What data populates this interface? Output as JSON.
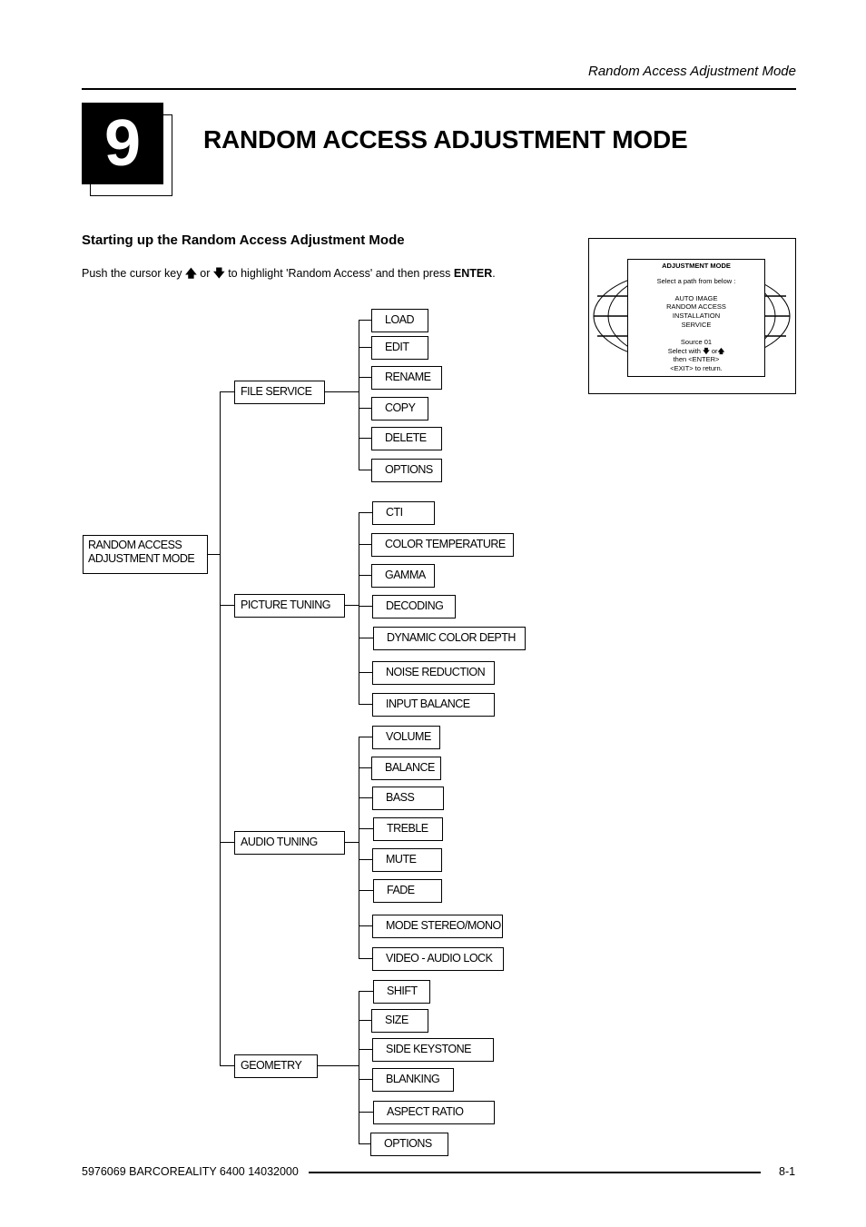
{
  "header": {
    "running_head": "Random Access Adjustment Mode"
  },
  "chapter": {
    "number": "9",
    "title": "RANDOM ACCESS ADJUSTMENT MODE"
  },
  "section": {
    "title": "Starting up the Random Access Adjustment Mode",
    "instruction": {
      "part1": "Push the cursor key ",
      "up_arrow": "🡅",
      "part2": " or ",
      "down_arrow": "🡇",
      "part3": " to highlight 'Random Access' and then press ",
      "key": "ENTER",
      "part4": "."
    }
  },
  "osd": {
    "title": "ADJUSTMENT MODE",
    "prompt": "Select  a  path  from  below  :",
    "options": [
      "AUTO  IMAGE",
      "RANDOM  ACCESS",
      "INSTALLATION",
      "SERVICE"
    ],
    "source": "Source  01",
    "select_with": "Select  with",
    "down_icon": "🡇",
    "or": "or",
    "up_icon": "🡅",
    "then": "then  <ENTER>",
    "exit": "<EXIT>  to  return."
  },
  "tree": {
    "root": {
      "line1": "RANDOM ACCESS",
      "line2": "ADJUSTMENT MODE"
    },
    "branches": [
      {
        "label": "FILE SERVICE",
        "children": [
          "LOAD",
          "EDIT",
          "RENAME",
          "COPY",
          "DELETE",
          "OPTIONS"
        ]
      },
      {
        "label": "PICTURE TUNING",
        "children": [
          "CTI",
          "COLOR TEMPERATURE",
          "GAMMA",
          "DECODING",
          "DYNAMIC COLOR DEPTH",
          "NOISE REDUCTION",
          "INPUT BALANCE"
        ]
      },
      {
        "label": "AUDIO TUNING",
        "children": [
          "VOLUME",
          "BALANCE",
          "BASS",
          "TREBLE",
          "MUTE",
          "FADE",
          "MODE STEREO/MONO",
          "VIDEO - AUDIO LOCK"
        ]
      },
      {
        "label": "GEOMETRY",
        "children": [
          "SHIFT",
          "SIZE",
          "SIDE KEYSTONE",
          "BLANKING",
          "ASPECT RATIO",
          "OPTIONS"
        ]
      }
    ]
  },
  "footer": {
    "doc_id": "5976069 BARCOREALITY 6400 14032000",
    "page": "8-1"
  }
}
